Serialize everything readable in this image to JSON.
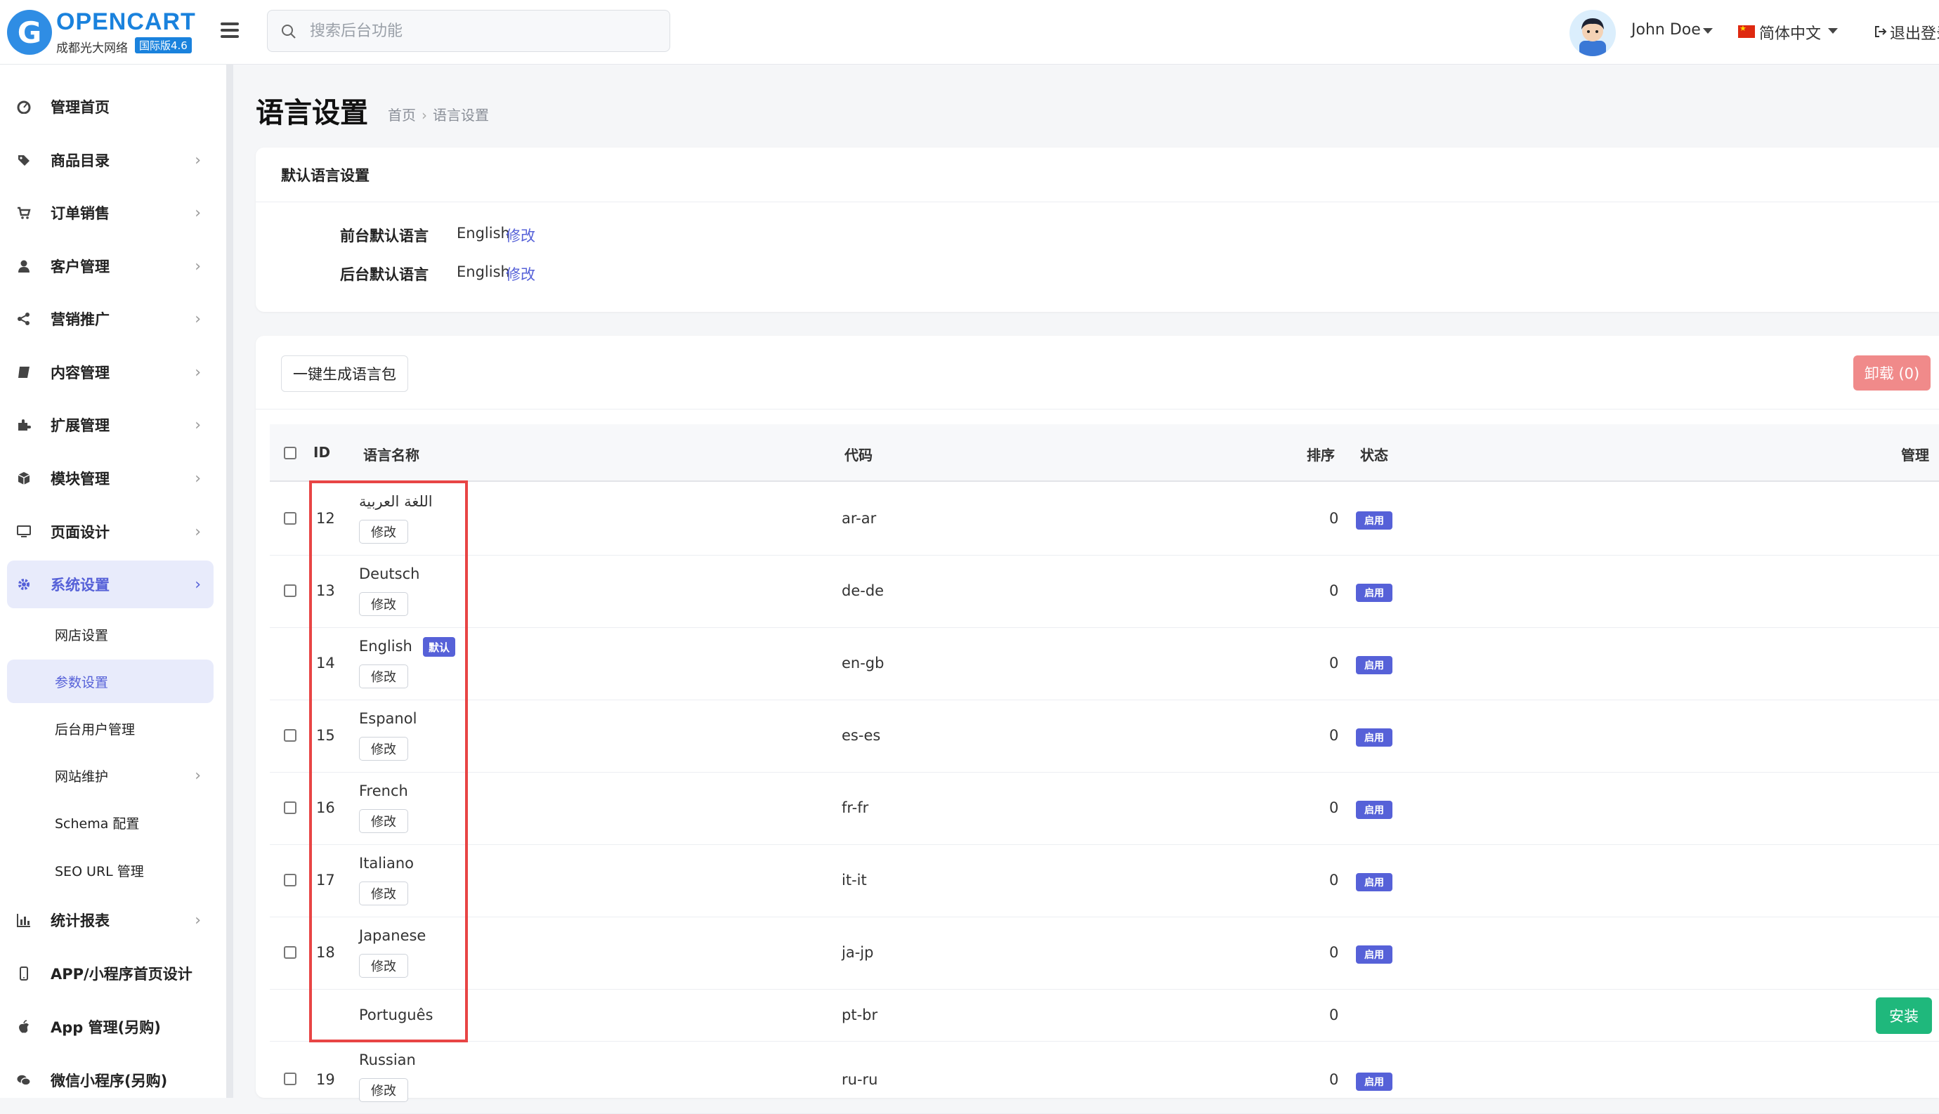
{
  "header": {
    "logo_letter": "G",
    "logo_title": "OPENCART",
    "logo_subtitle": "成都光大网络",
    "logo_badge": "国际版4.6",
    "search_placeholder": "搜索后台功能",
    "user_name": "John Doe",
    "language": "简体中文",
    "logout": "退出登录"
  },
  "sidebar": {
    "items": [
      {
        "label": "管理首页",
        "icon": "dashboard-icon"
      },
      {
        "label": "商品目录",
        "icon": "tags-icon"
      },
      {
        "label": "订单销售",
        "icon": "cart-icon"
      },
      {
        "label": "客户管理",
        "icon": "user-icon"
      },
      {
        "label": "营销推广",
        "icon": "share-icon"
      },
      {
        "label": "内容管理",
        "icon": "book-icon"
      },
      {
        "label": "扩展管理",
        "icon": "puzzle-icon"
      },
      {
        "label": "模块管理",
        "icon": "cube-icon"
      },
      {
        "label": "页面设计",
        "icon": "desktop-icon"
      },
      {
        "label": "系统设置",
        "icon": "gear-icon"
      },
      {
        "label": "统计报表",
        "icon": "bar-chart-icon"
      },
      {
        "label": "APP/小程序首页设计",
        "icon": "mobile-icon"
      },
      {
        "label": "App 管理(另购)",
        "icon": "apple-icon"
      },
      {
        "label": "微信小程序(另购)",
        "icon": "wechat-icon"
      }
    ],
    "sub_items": [
      {
        "label": "网店设置"
      },
      {
        "label": "参数设置"
      },
      {
        "label": "后台用户管理"
      },
      {
        "label": "网站维护"
      },
      {
        "label": "Schema 配置"
      },
      {
        "label": "SEO URL 管理"
      }
    ],
    "chevron": "›"
  },
  "main": {
    "title": "语言设置",
    "breadcrumb": {
      "home": "首页",
      "sep": "›",
      "current": "语言设置"
    },
    "default_card": {
      "title": "默认语言设置",
      "rows": [
        {
          "label": "前台默认语言",
          "value": "English",
          "edit": "修改"
        },
        {
          "label": "后台默认语言",
          "value": "English",
          "edit": "修改"
        }
      ]
    },
    "toolbar": {
      "generate": "一键生成语言包",
      "uninstall": "卸载 (0)"
    },
    "table": {
      "headers": {
        "id": "ID",
        "name": "语言名称",
        "code": "代码",
        "sort": "排序",
        "status": "状态",
        "manage": "管理"
      },
      "edit_label": "修改",
      "status_label": "启用",
      "default_label": "默认",
      "install_label": "安装",
      "rows": [
        {
          "id": "12",
          "name": "اللغة العربية",
          "code": "ar-ar",
          "sort": "0"
        },
        {
          "id": "13",
          "name": "Deutsch",
          "code": "de-de",
          "sort": "0"
        },
        {
          "id": "14",
          "name": "English",
          "code": "en-gb",
          "sort": "0"
        },
        {
          "id": "15",
          "name": "Espanol",
          "code": "es-es",
          "sort": "0"
        },
        {
          "id": "16",
          "name": "French",
          "code": "fr-fr",
          "sort": "0"
        },
        {
          "id": "17",
          "name": "Italiano",
          "code": "it-it",
          "sort": "0"
        },
        {
          "id": "18",
          "name": "Japanese",
          "code": "ja-jp",
          "sort": "0"
        },
        {
          "id": "",
          "name": "Português",
          "code": "pt-br",
          "sort": "0"
        },
        {
          "id": "19",
          "name": "Russian",
          "code": "ru-ru",
          "sort": "0"
        }
      ]
    }
  },
  "colors": {
    "accent": "#5661d8",
    "install": "#1fb87c",
    "uninstall": "#f08a8a",
    "highlight": "#e84545",
    "logo": "#1a82dd"
  }
}
